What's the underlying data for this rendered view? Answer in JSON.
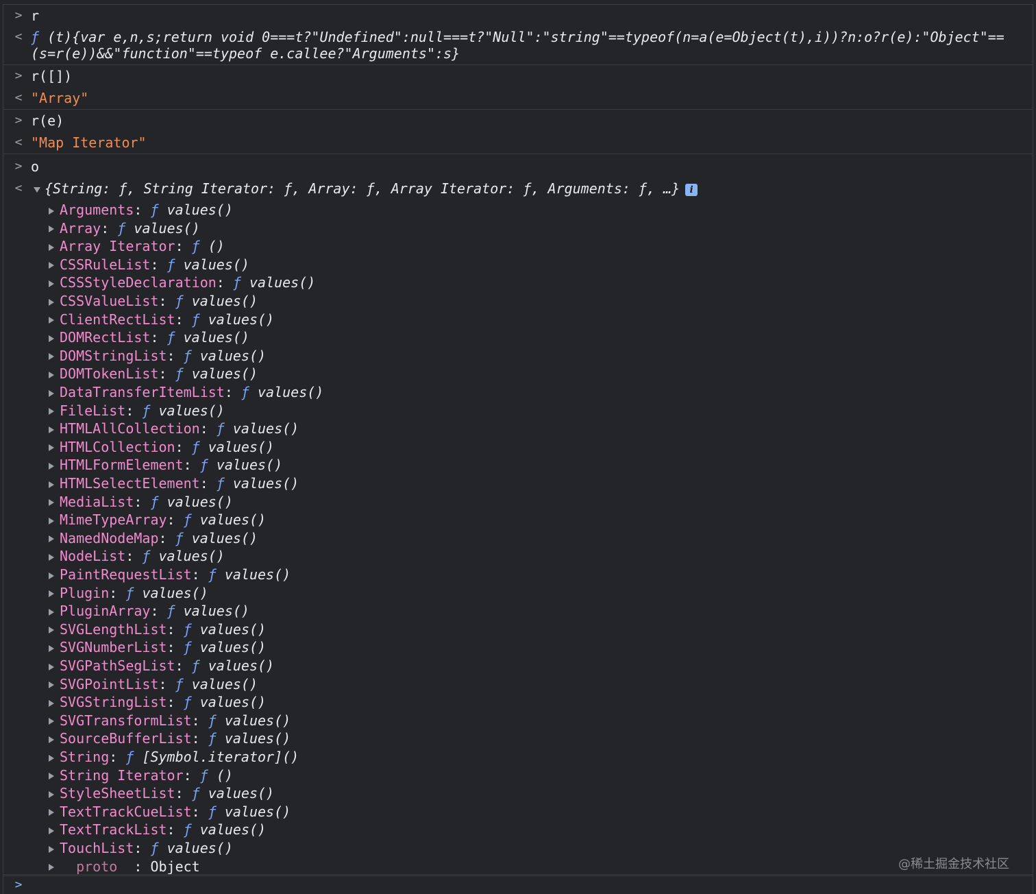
{
  "console": {
    "entries": [
      {
        "input": "r",
        "output_line1": " (t){var e,n,s;return void 0===t?\"Undefined\":null===t?\"Null\":\"string\"==typeof(n=a(e=Object(t),i))?n:o?r(e):\"Object\"==",
        "output_line2": "(s=r(e))&&\"function\"==typeof e.callee?\"Arguments\":s}",
        "output_f": "ƒ"
      },
      {
        "input": "r([])",
        "output": "\"Array\""
      },
      {
        "input": "r(e)",
        "output": "\"Map Iterator\""
      },
      {
        "input": "o",
        "summary": "{String: ƒ, String Iterator: ƒ, Array: ƒ, Array Iterator: ƒ, Arguments: ƒ, …}",
        "info_icon": "i"
      }
    ],
    "prompt_in": ">",
    "prompt_out": "<"
  },
  "properties": [
    {
      "key": "Arguments",
      "fn": "values()"
    },
    {
      "key": "Array",
      "fn": "values()"
    },
    {
      "key": "Array Iterator",
      "fn": "()"
    },
    {
      "key": "CSSRuleList",
      "fn": "values()"
    },
    {
      "key": "CSSStyleDeclaration",
      "fn": "values()"
    },
    {
      "key": "CSSValueList",
      "fn": "values()"
    },
    {
      "key": "ClientRectList",
      "fn": "values()"
    },
    {
      "key": "DOMRectList",
      "fn": "values()"
    },
    {
      "key": "DOMStringList",
      "fn": "values()"
    },
    {
      "key": "DOMTokenList",
      "fn": "values()"
    },
    {
      "key": "DataTransferItemList",
      "fn": "values()"
    },
    {
      "key": "FileList",
      "fn": "values()"
    },
    {
      "key": "HTMLAllCollection",
      "fn": "values()"
    },
    {
      "key": "HTMLCollection",
      "fn": "values()"
    },
    {
      "key": "HTMLFormElement",
      "fn": "values()"
    },
    {
      "key": "HTMLSelectElement",
      "fn": "values()"
    },
    {
      "key": "MediaList",
      "fn": "values()"
    },
    {
      "key": "MimeTypeArray",
      "fn": "values()"
    },
    {
      "key": "NamedNodeMap",
      "fn": "values()"
    },
    {
      "key": "NodeList",
      "fn": "values()"
    },
    {
      "key": "PaintRequestList",
      "fn": "values()"
    },
    {
      "key": "Plugin",
      "fn": "values()"
    },
    {
      "key": "PluginArray",
      "fn": "values()"
    },
    {
      "key": "SVGLengthList",
      "fn": "values()"
    },
    {
      "key": "SVGNumberList",
      "fn": "values()"
    },
    {
      "key": "SVGPathSegList",
      "fn": "values()"
    },
    {
      "key": "SVGPointList",
      "fn": "values()"
    },
    {
      "key": "SVGStringList",
      "fn": "values()"
    },
    {
      "key": "SVGTransformList",
      "fn": "values()"
    },
    {
      "key": "SourceBufferList",
      "fn": "values()"
    },
    {
      "key": "String",
      "fn": "[Symbol.iterator]()"
    },
    {
      "key": "String Iterator",
      "fn": "()"
    },
    {
      "key": "StyleSheetList",
      "fn": "values()"
    },
    {
      "key": "TextTrackCueList",
      "fn": "values()"
    },
    {
      "key": "TextTrackList",
      "fn": "values()"
    },
    {
      "key": "TouchList",
      "fn": "values()"
    }
  ],
  "proto": {
    "key": "__proto__",
    "value": "Object"
  },
  "watermark": "@稀土掘金技术社区",
  "colors": {
    "background": "#242528",
    "string": "#f28b54",
    "key": "#f28bce",
    "function_f": "#7aa2f7"
  },
  "icons": {
    "expand": "triangle-right-icon",
    "collapse": "triangle-down-icon",
    "info": "info-icon"
  }
}
